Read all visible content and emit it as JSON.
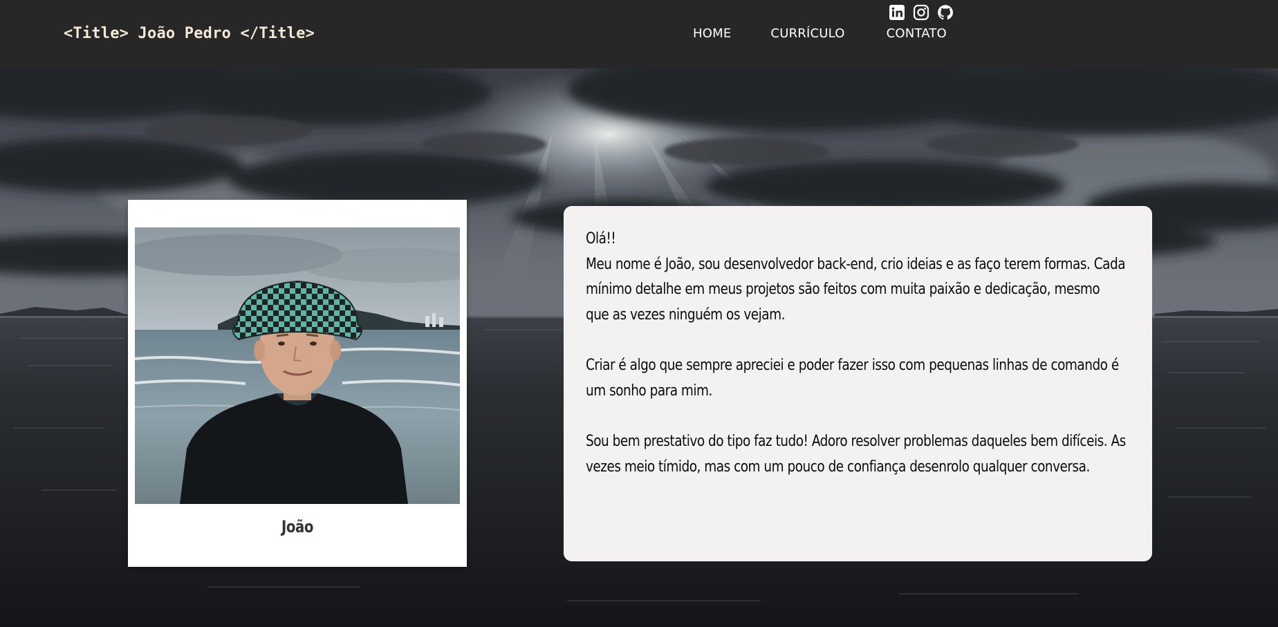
{
  "header": {
    "brand": "<Title> João Pedro </Title>",
    "nav": {
      "home": "HOME",
      "curriculo": "CURRÍCULO",
      "contato": "CONTATO"
    },
    "social": [
      "linkedin-icon",
      "instagram-icon",
      "github-icon"
    ]
  },
  "profile": {
    "caption": "João"
  },
  "about": {
    "greeting": "Olá!!",
    "paragraph1": "Meu nome é João, sou desenvolvedor back-end, crio ideias e as faço terem formas. Cada mínimo detalhe em meus projetos são feitos com muita paixão e dedicação, mesmo que as vezes ninguém os vejam.",
    "paragraph2": "Criar é algo que sempre apreciei e poder fazer isso com pequenas linhas de comando é um sonho para mim.",
    "paragraph3": "Sou bem prestativo do tipo faz tudo! Adoro resolver problemas daqueles bem difíceis. As vezes meio tímido, mas com um pouco de confiança desenrolo qualquer conversa."
  },
  "colors": {
    "header_bg": "#272727",
    "brand_text": "#f3e9d6",
    "nav_text": "#ffffff",
    "card_bg": "#f4f1f3",
    "polaroid_bg": "#ffffff"
  }
}
